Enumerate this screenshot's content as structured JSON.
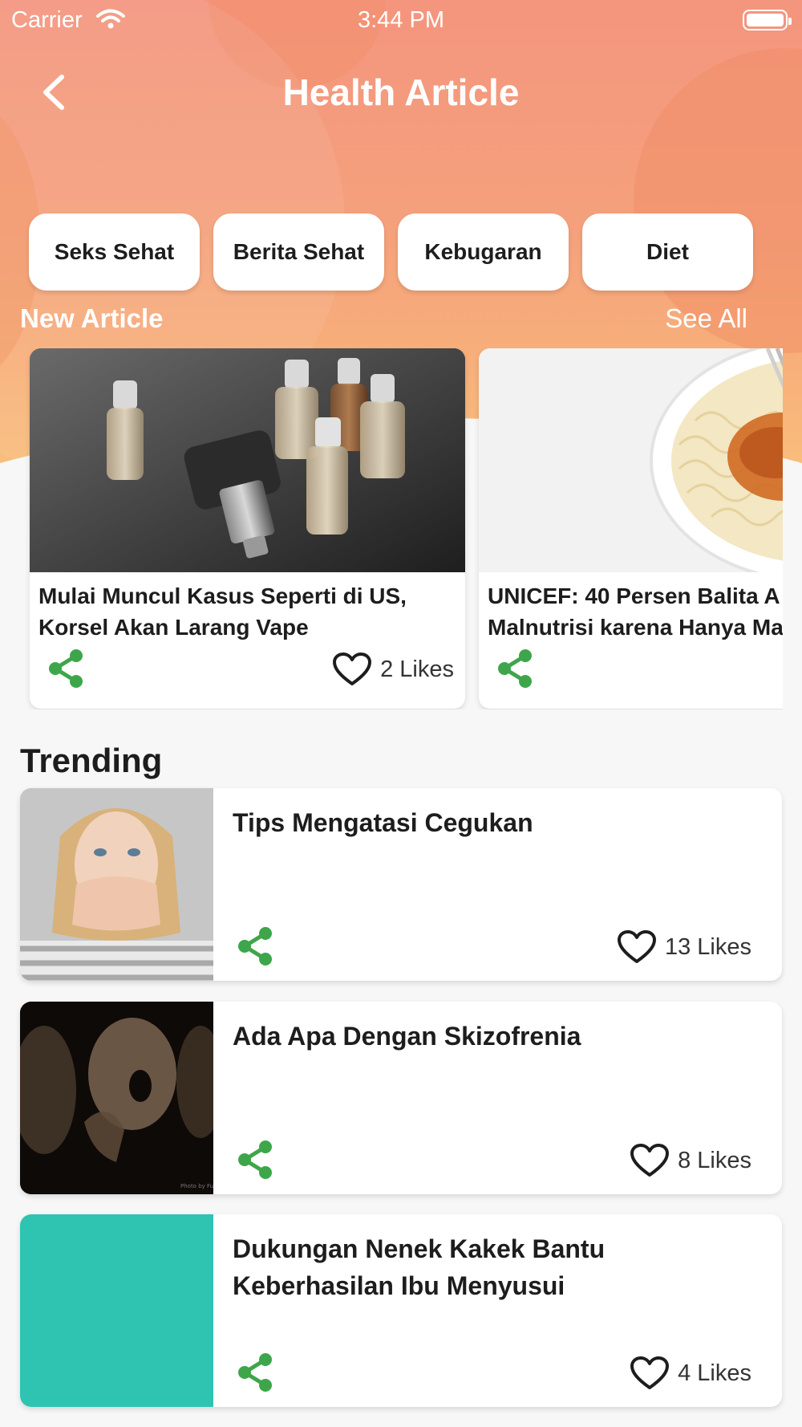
{
  "status_bar": {
    "carrier": "Carrier",
    "time": "3:44 PM"
  },
  "header": {
    "title": "Health Article"
  },
  "categories": [
    {
      "label": "Seks Sehat"
    },
    {
      "label": "Berita Sehat"
    },
    {
      "label": "Kebugaran"
    },
    {
      "label": "Diet"
    }
  ],
  "new_article": {
    "section_title": "New Article",
    "see_all_label": "See All",
    "items": [
      {
        "title_line1": "Mulai Muncul Kasus Seperti di US,",
        "title_line2": "Korsel Akan Larang Vape",
        "likes": "2 Likes",
        "image": "vape-bottles-photo"
      },
      {
        "title_line1": "UNICEF: 40 Persen Balita A",
        "title_line2": "Malnutrisi karena Hanya Ma",
        "image": "noodle-bowl-photo"
      }
    ]
  },
  "trending": {
    "section_title": "Trending",
    "items": [
      {
        "title": "Tips Mengatasi Cegukan",
        "likes": "13 Likes",
        "image": "woman-covering-mouth-photo"
      },
      {
        "title": "Ada Apa Dengan Skizofrenia",
        "likes": "8 Likes",
        "image": "screaming-faces-photo",
        "image_credit": "Photo by Fuzzle"
      },
      {
        "title": "Dukungan Nenek Kakek Bantu Keberhasilan Ibu Menyusui",
        "likes": "4 Likes",
        "image": "teal-placeholder"
      }
    ]
  },
  "colors": {
    "header_gradient_top": "#f4957e",
    "header_gradient_bottom": "#f9c47c",
    "share_icon": "#3ea64a",
    "teal_thumbnail": "#2fc4b2"
  }
}
